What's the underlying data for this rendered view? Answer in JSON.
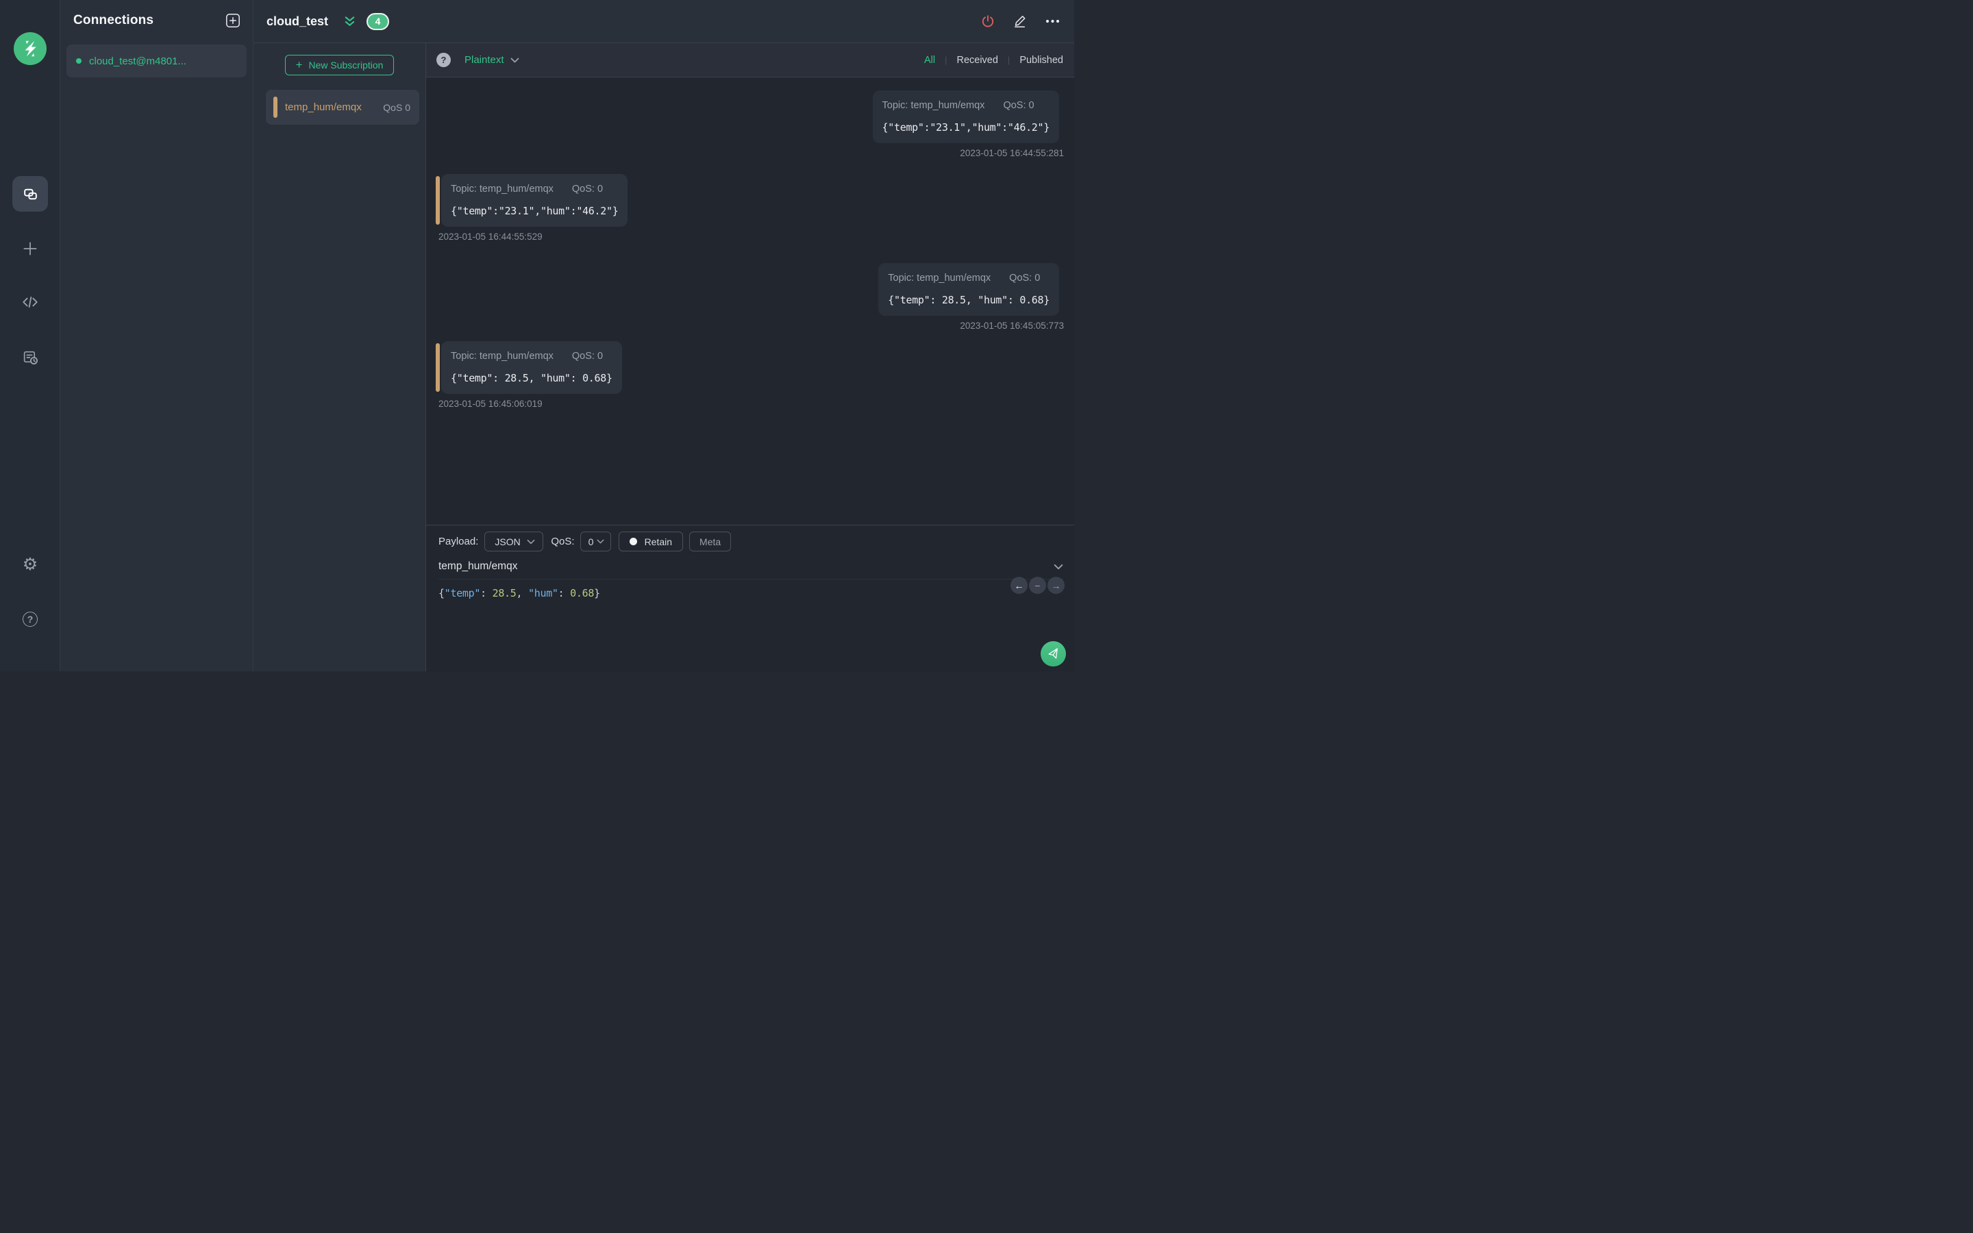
{
  "colors": {
    "accent_green": "#34c388",
    "subscription_accent": "#c9a16f",
    "disconnect_red": "#e0615e",
    "json_key": "#6fb3ec",
    "json_number": "#b5cc82",
    "panel_bg": "#2a303a",
    "message_bg": "#22262e"
  },
  "sidebar": {
    "items": [
      {
        "icon": "connections-icon",
        "active": true
      },
      {
        "icon": "plus-icon"
      },
      {
        "icon": "code-icon"
      },
      {
        "icon": "log-icon"
      },
      {
        "icon": "gear-icon",
        "glyph": "⚙"
      },
      {
        "icon": "help-icon",
        "glyph": "?"
      }
    ]
  },
  "connections": {
    "title": "Connections",
    "items": [
      {
        "name": "cloud_test@m4801...",
        "status": "connected"
      }
    ]
  },
  "header": {
    "title": "cloud_test",
    "badge": "4"
  },
  "subscriptions": {
    "new_button_label": "New Subscription",
    "new_button_plus": "+",
    "items": [
      {
        "topic": "temp_hum/emqx",
        "qos": "QoS 0"
      }
    ]
  },
  "toolbar": {
    "format": "Plaintext",
    "filters": {
      "all": "All",
      "received": "Received",
      "published": "Published"
    },
    "active_filter": "All",
    "separator": "|"
  },
  "messages": [
    {
      "direction": "published",
      "topic_line": "Topic: temp_hum/emqx",
      "qos_line": "QoS: 0",
      "payload": "{\"temp\":\"23.1\",\"hum\":\"46.2\"}",
      "timestamp": "2023-01-05 16:44:55:281"
    },
    {
      "direction": "received",
      "topic_line": "Topic: temp_hum/emqx",
      "qos_line": "QoS: 0",
      "payload": "{\"temp\":\"23.1\",\"hum\":\"46.2\"}",
      "timestamp": "2023-01-05 16:44:55:529"
    },
    {
      "direction": "published",
      "topic_line": "Topic: temp_hum/emqx",
      "qos_line": "QoS: 0",
      "payload": "{\"temp\": 28.5, \"hum\": 0.68}",
      "timestamp": "2023-01-05 16:45:05:773"
    },
    {
      "direction": "received",
      "topic_line": "Topic: temp_hum/emqx",
      "qos_line": "QoS: 0",
      "payload": "{\"temp\": 28.5, \"hum\": 0.68}",
      "timestamp": "2023-01-05 16:45:06:019"
    }
  ],
  "publish": {
    "payload_label": "Payload:",
    "format_value": "JSON",
    "qos_label": "QoS:",
    "qos_value": "0",
    "retain_label": "Retain",
    "meta_label": "Meta",
    "topic_value": "temp_hum/emqx",
    "payload_tokens": [
      {
        "text": "{",
        "type": "punct"
      },
      {
        "text": "\"temp\"",
        "type": "key"
      },
      {
        "text": ": ",
        "type": "punct"
      },
      {
        "text": "28.5",
        "type": "number"
      },
      {
        "text": ", ",
        "type": "punct"
      },
      {
        "text": "\"hum\"",
        "type": "key"
      },
      {
        "text": ": ",
        "type": "punct"
      },
      {
        "text": "0.68",
        "type": "number"
      },
      {
        "text": "}",
        "type": "punct"
      }
    ]
  }
}
